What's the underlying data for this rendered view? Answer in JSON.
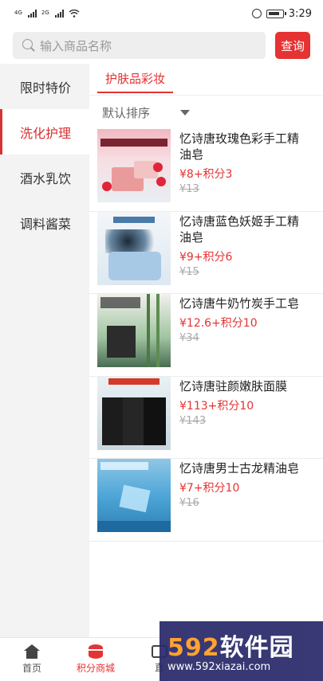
{
  "status_bar": {
    "signal1_tag": "4G",
    "signal2_tag": "2G",
    "time": "3:29"
  },
  "search": {
    "placeholder": "输入商品名称",
    "button_label": "查询"
  },
  "sidebar": {
    "items": [
      {
        "label": "限时特价"
      },
      {
        "label": "洗化护理"
      },
      {
        "label": "酒水乳饮"
      },
      {
        "label": "调料酱菜"
      }
    ],
    "active_index": 1
  },
  "category_tab": {
    "label": "护肤品彩妆"
  },
  "sort": {
    "label": "默认排序"
  },
  "products": [
    {
      "name": "忆诗唐玫瑰色彩手工精油皂",
      "price": "¥8+积分3",
      "original_price": "¥13"
    },
    {
      "name": "忆诗唐蓝色妖姬手工精油皂",
      "price": "¥9+积分6",
      "original_price": "¥15"
    },
    {
      "name": "忆诗唐牛奶竹炭手工皂",
      "price": "¥12.6+积分10",
      "original_price": "¥34"
    },
    {
      "name": "忆诗唐驻颜嫩肤面膜",
      "price": "¥113+积分10",
      "original_price": "¥143"
    },
    {
      "name": "忆诗唐男士古龙精油皂",
      "price": "¥7+积分10",
      "original_price": "¥16"
    }
  ],
  "bottom_nav": {
    "items": [
      {
        "label": "首页",
        "icon": "home-icon"
      },
      {
        "label": "积分商城",
        "icon": "database-icon"
      },
      {
        "label": "直",
        "icon": "live-icon"
      }
    ],
    "active_index": 1
  },
  "watermark": {
    "brand_digits": "592",
    "brand_text": "软件园",
    "url": "www.592xiazai.com"
  },
  "colors": {
    "accent": "#e63232",
    "sidebar_bg": "#f3f3f3"
  }
}
